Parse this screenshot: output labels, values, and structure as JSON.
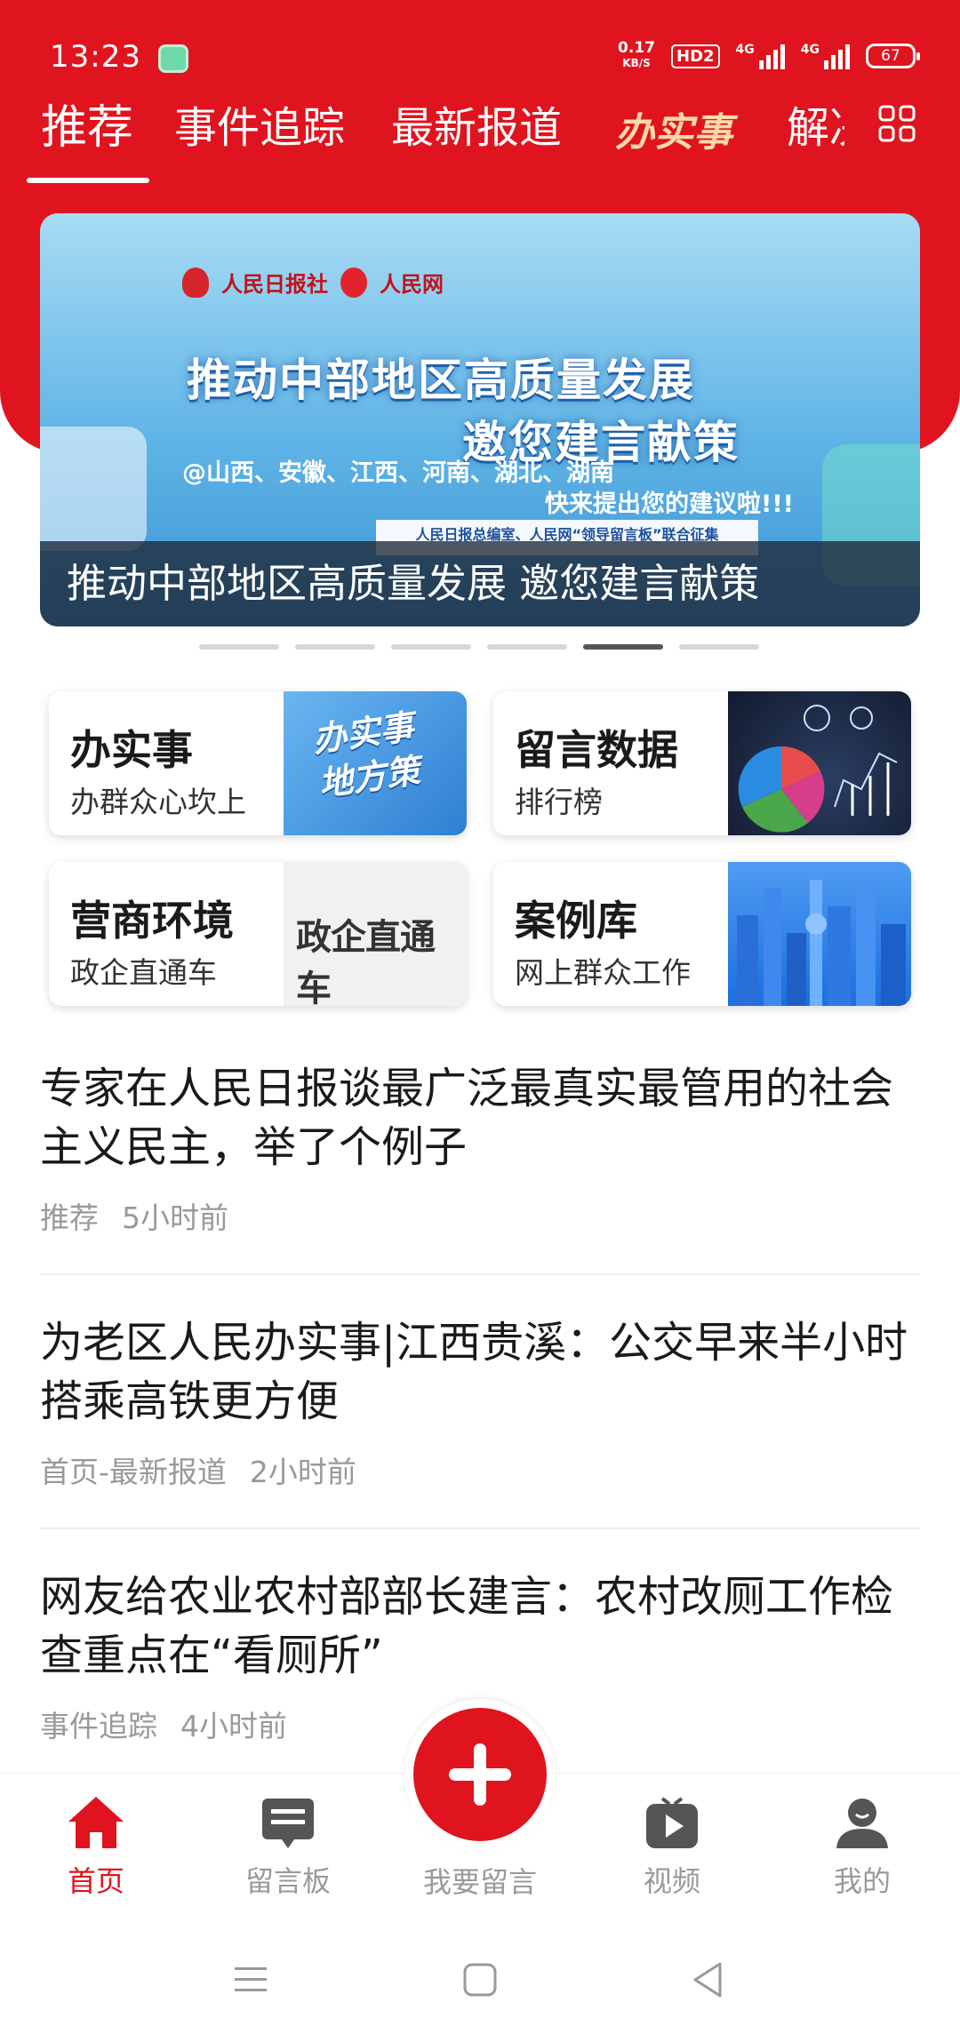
{
  "status_bar": {
    "time": "13:23",
    "net_speed_value": "0.17",
    "net_speed_unit": "KB/S",
    "hd_label": "HD2",
    "signal1_label": "4G",
    "signal2_label": "4G",
    "battery": "67"
  },
  "tabs": [
    {
      "label": "推荐",
      "active": true
    },
    {
      "label": "事件追踪"
    },
    {
      "label": "最新报道"
    },
    {
      "label": "办实事"
    },
    {
      "label": "解决"
    }
  ],
  "banner": {
    "logo_left": "人民日报社",
    "logo_right": "人民网",
    "title_line1": "推动中部地区高质量发展",
    "title_line2": "邀您建言献策",
    "sub_line1": "@山西、安徽、江西、河南、湖北、湖南",
    "sub_line2": "快来提出您的建议啦!!!",
    "strip_text": "人民日报总编室、人民网“领导留言板”联合征集",
    "caption": "推动中部地区高质量发展 邀您建言献策",
    "dots_count": 6,
    "active_dot": 5
  },
  "cards": [
    {
      "title": "办实事",
      "subtitle": "办群众心坎上",
      "image_text": "办实事\n地方策"
    },
    {
      "title": "留言数据",
      "subtitle": "排行榜"
    },
    {
      "title": "营商环境",
      "subtitle": "政企直通车",
      "image_text": "政企直通车"
    },
    {
      "title": "案例库",
      "subtitle": "网上群众工作"
    }
  ],
  "news": [
    {
      "title": "专家在人民日报谈最广泛最真实最管用的社会主义民主，举了个例子",
      "category": "推荐",
      "time": "5小时前"
    },
    {
      "title": "为老区人民办实事|江西贵溪：公交早来半小时 搭乘高铁更方便",
      "category": "首页-最新报道",
      "time": "2小时前"
    },
    {
      "title": "网友给农业农村部部长建言：农村改厕工作检查重点在“看厕所”",
      "category": "事件追踪",
      "time": "4小时前"
    }
  ],
  "bottom_nav": {
    "home": "首页",
    "board": "留言板",
    "post": "我要留言",
    "video": "视频",
    "mine": "我的"
  },
  "colors": {
    "accent": "#e0141e",
    "muted": "#999999"
  }
}
